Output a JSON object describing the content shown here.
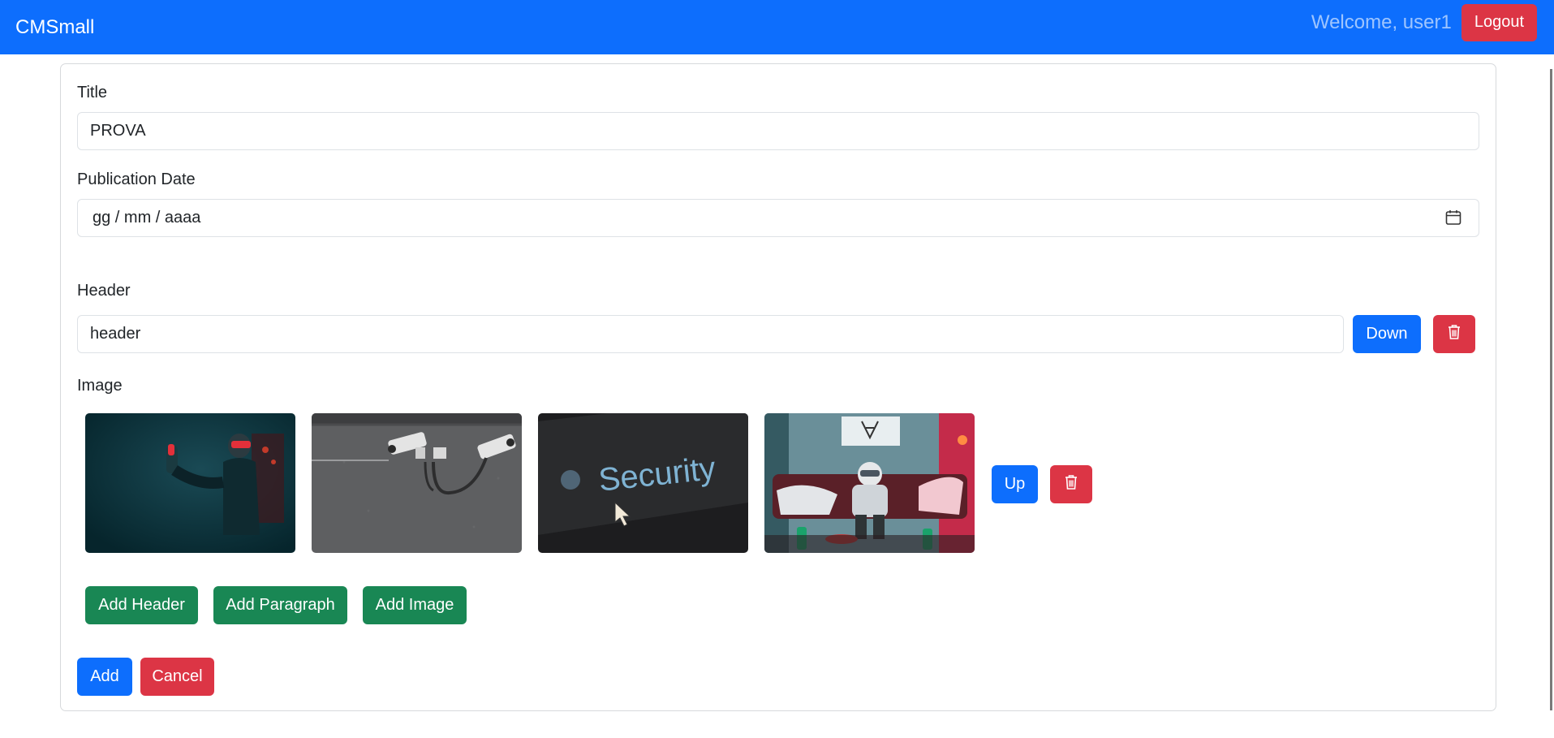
{
  "navbar": {
    "brand": "CMSmall",
    "welcome": "Welcome, user1",
    "logout_label": "Logout",
    "color": "#0d6efd"
  },
  "form": {
    "title_label": "Title",
    "title_value": "PROVA",
    "date_label": "Publication Date",
    "date_value": "gg / mm / aaaa",
    "blocks": [
      {
        "type_label": "Header",
        "value": "header",
        "move_label": "Down",
        "delete_icon": "trash-icon"
      },
      {
        "type_label": "Image",
        "move_label": "Up",
        "delete_icon": "trash-icon",
        "images": [
          {
            "name": "vr-headset-woman-image"
          },
          {
            "name": "security-cameras-wall-image"
          },
          {
            "name": "security-screen-cursor-image",
            "text": "Security"
          },
          {
            "name": "astronaut-on-couch-image"
          }
        ]
      }
    ],
    "add_buttons": {
      "header": "Add Header",
      "paragraph": "Add Paragraph",
      "image": "Add Image"
    },
    "submit_label": "Add",
    "cancel_label": "Cancel"
  },
  "colors": {
    "primary": "#0d6efd",
    "danger": "#dc3545",
    "success": "#198754"
  }
}
